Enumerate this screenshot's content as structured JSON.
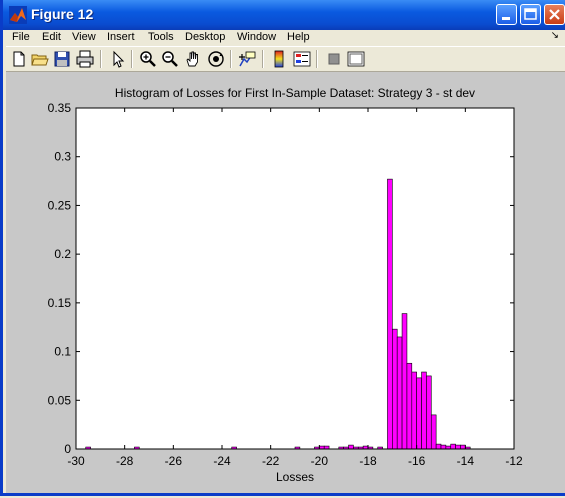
{
  "window": {
    "title": "Figure 12"
  },
  "menu": [
    "File",
    "Edit",
    "View",
    "Insert",
    "Tools",
    "Desktop",
    "Window",
    "Help"
  ],
  "toolbar": [
    "new-file-icon",
    "open-folder-icon",
    "save-icon",
    "print-icon",
    "pointer-icon",
    "zoom-in-icon",
    "zoom-out-icon",
    "pan-hand-icon",
    "rotate-3d-icon",
    "data-cursor-icon",
    "colorbar-icon",
    "legend-icon",
    "hide-plot-tools-icon",
    "show-plot-tools-icon"
  ],
  "colors": {
    "bar": "#ff00ff",
    "figure_bg": "#c8c8c8",
    "axes_bg": "#ffffff"
  },
  "chart_data": {
    "type": "bar",
    "title": "Histogram of Losses for First In-Sample Dataset: Strategy 3 - st dev",
    "xlabel": "Losses",
    "ylabel": "",
    "xlim": [
      -30,
      -12
    ],
    "ylim": [
      0,
      0.35
    ],
    "xticks": [
      -30,
      -28,
      -26,
      -24,
      -22,
      -20,
      -18,
      -16,
      -14,
      -12
    ],
    "yticks": [
      0,
      0.05,
      0.1,
      0.15,
      0.2,
      0.25,
      0.3,
      0.35
    ],
    "xtick_labels": [
      "-30",
      "-28",
      "-26",
      "-24",
      "-22",
      "-20",
      "-18",
      "-16",
      "-14",
      "-12"
    ],
    "ytick_labels": [
      "0",
      "0.05",
      "0.1",
      "0.15",
      "0.2",
      "0.25",
      "0.3",
      "0.35"
    ],
    "bin_width": 0.2,
    "bins": [
      {
        "x": -29.5,
        "y": 0.002
      },
      {
        "x": -27.5,
        "y": 0.002
      },
      {
        "x": -23.5,
        "y": 0.002
      },
      {
        "x": -20.9,
        "y": 0.002
      },
      {
        "x": -20.1,
        "y": 0.002
      },
      {
        "x": -19.9,
        "y": 0.003
      },
      {
        "x": -19.7,
        "y": 0.003
      },
      {
        "x": -19.1,
        "y": 0.002
      },
      {
        "x": -18.9,
        "y": 0.002
      },
      {
        "x": -18.7,
        "y": 0.004
      },
      {
        "x": -18.5,
        "y": 0.002
      },
      {
        "x": -18.3,
        "y": 0.002
      },
      {
        "x": -18.1,
        "y": 0.003
      },
      {
        "x": -17.9,
        "y": 0.002
      },
      {
        "x": -17.5,
        "y": 0.002
      },
      {
        "x": -17.1,
        "y": 0.277
      },
      {
        "x": -16.9,
        "y": 0.123
      },
      {
        "x": -16.7,
        "y": 0.115
      },
      {
        "x": -16.5,
        "y": 0.139
      },
      {
        "x": -16.3,
        "y": 0.088
      },
      {
        "x": -16.1,
        "y": 0.079
      },
      {
        "x": -15.9,
        "y": 0.073
      },
      {
        "x": -15.7,
        "y": 0.079
      },
      {
        "x": -15.5,
        "y": 0.075
      },
      {
        "x": -15.3,
        "y": 0.035
      },
      {
        "x": -15.1,
        "y": 0.005
      },
      {
        "x": -14.9,
        "y": 0.004
      },
      {
        "x": -14.7,
        "y": 0.003
      },
      {
        "x": -14.5,
        "y": 0.005
      },
      {
        "x": -14.3,
        "y": 0.004
      },
      {
        "x": -14.1,
        "y": 0.004
      },
      {
        "x": -13.9,
        "y": 0.002
      }
    ]
  }
}
